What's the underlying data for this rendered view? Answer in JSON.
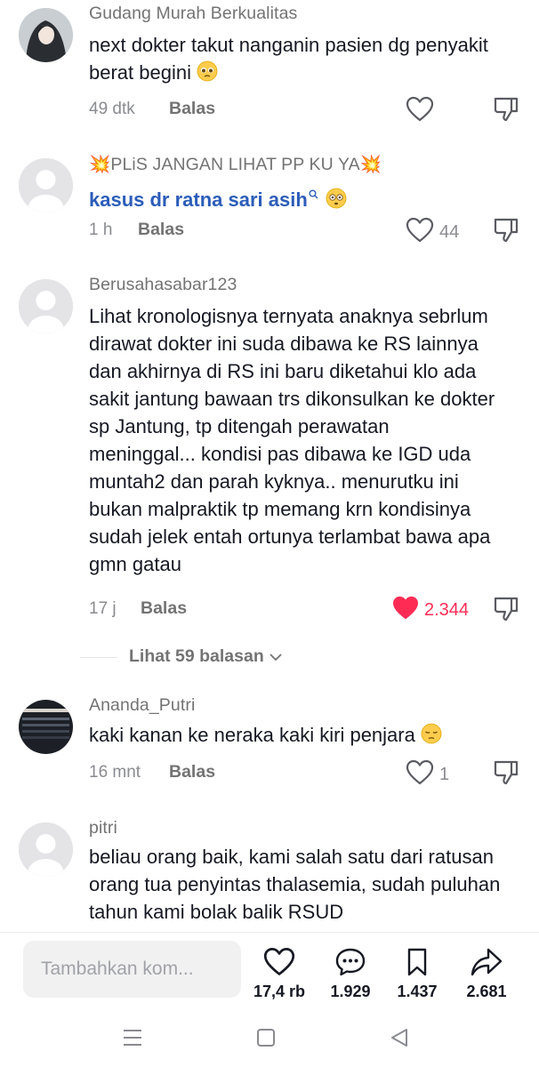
{
  "comments": [
    {
      "username": "Gudang Murah Berkualitas",
      "text": "next dokter takut nanganin pasien dg penyakit berat begini",
      "time": "49 dtk",
      "reply": "Balas",
      "likes": "",
      "liked": false
    },
    {
      "username": "💥PLiS JANGAN LIHAT PP KU YA💥",
      "text": "kasus dr ratna sari asih",
      "time": "1 h",
      "reply": "Balas",
      "likes": "44",
      "liked": false
    },
    {
      "username": "Berusahasabar123",
      "text": "Lihat kronologisnya ternyata anaknya sebrlum dirawat dokter ini suda dibawa ke RS lainnya dan akhirnya di RS ini baru diketahui klo ada sakit jantung bawaan trs dikonsulkan ke dokter sp Jantung, tp ditengah perawatan meninggal... kondisi pas dibawa ke IGD uda muntah2 dan parah kyknya.. menurutku ini bukan malpraktik tp memang krn kondisinya sudah jelek entah ortunya terlambat bawa apa gmn gatau",
      "time": "17 j",
      "reply": "Balas",
      "likes": "2.344",
      "liked": true
    },
    {
      "username": "Ananda_Putri",
      "text": "kaki kanan ke neraka kaki kiri penjara",
      "time": "16 mnt",
      "reply": "Balas",
      "likes": "1",
      "liked": false
    },
    {
      "username": "pitri",
      "text": "beliau orang baik, kami salah satu dari ratusan orang tua penyintas thalasemia, sudah puluhan tahun kami bolak balik RSUD"
    }
  ],
  "view_replies": "Lihat 59 balasan",
  "input": {
    "placeholder": "Tambahkan kom..."
  },
  "actions": [
    {
      "icon": "heart-icon",
      "count": "17,4 rb"
    },
    {
      "icon": "message-icon",
      "count": "1.929"
    },
    {
      "icon": "bookmark-icon",
      "count": "1.437"
    },
    {
      "icon": "share-icon",
      "count": "2.681"
    }
  ],
  "colors": {
    "link": "#2b5db9",
    "liked": "#fe2c55",
    "muted": "#8a8b91"
  }
}
